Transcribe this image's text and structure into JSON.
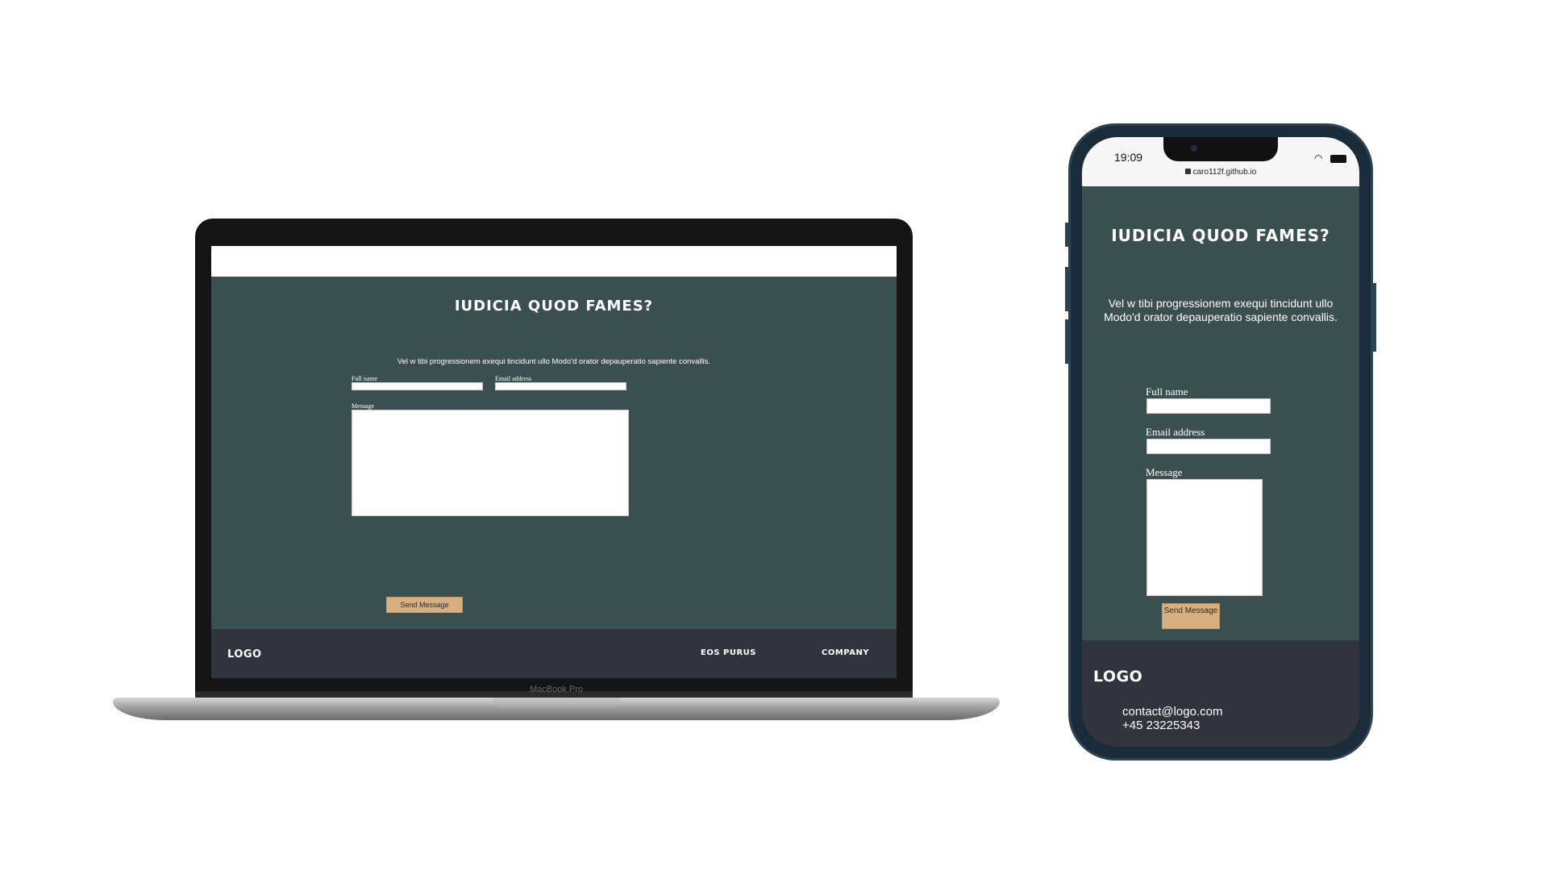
{
  "laptop": {
    "brand_label": "MacBook Pro",
    "page": {
      "title": "IUDICIA QUOD FAMES?",
      "intro": "Vel w tibi progressionem exequi tincidunt ullo Modo'd orator depauperatio sapiente convallis.",
      "form": {
        "full_name_label": "Full name",
        "email_label": "Email address",
        "message_label": "Message",
        "send_label": "Send Message"
      },
      "footer": {
        "logo": "LOGO",
        "nav": [
          "EOS PURUS",
          "COMPANY"
        ]
      }
    }
  },
  "phone": {
    "status": {
      "time": "19:09",
      "url": "caro112f.github.io"
    },
    "page": {
      "title": "IUDICIA QUOD FAMES?",
      "intro": "Vel w tibi progressionem exequi tincidunt ullo Modo'd orator depauperatio sapiente convallis.",
      "form": {
        "full_name_label": "Full name",
        "email_label": "Email address",
        "message_label": "Message",
        "send_label": "Send Message"
      },
      "footer": {
        "logo": "LOGO",
        "email": "contact@logo.com",
        "phone": "+45 23225343"
      }
    }
  },
  "colors": {
    "page_bg": "#3a4f50",
    "footer_bg": "#30343c",
    "button_bg": "#d8b07f"
  }
}
